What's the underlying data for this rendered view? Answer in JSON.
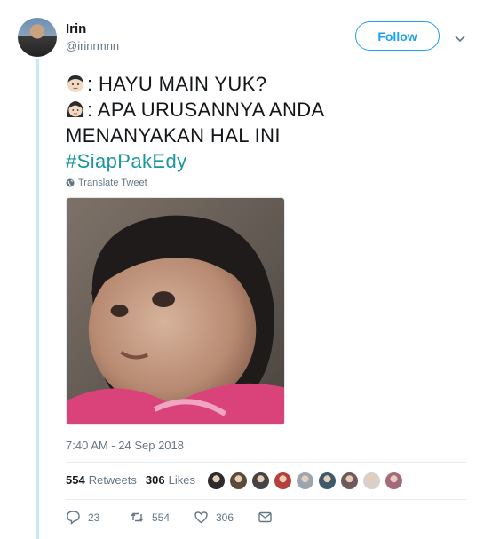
{
  "author": {
    "display_name": "Irin",
    "username": "@irinrmnn"
  },
  "follow_label": "Follow",
  "tweet": {
    "line1": ": HAYU MAIN YUK?",
    "line2": ": APA URUSANNYA ANDA",
    "line3": "MENANYAKAN HAL INI",
    "hashtag": "#SiapPakEdy",
    "emoji1": "boy-face-icon",
    "emoji2": "woman-face-icon"
  },
  "translate_label": "Translate Tweet",
  "timestamp": "7:40 AM - 24 Sep 2018",
  "stats": {
    "retweets_count": "554",
    "retweets_label": "Retweets",
    "likes_count": "306",
    "likes_label": "Likes"
  },
  "liker_avatar_colors": [
    "#2b2b2b",
    "#5a4a3a",
    "#444444",
    "#b8403c",
    "#9aa5b1",
    "#3d5a6b",
    "#6e5a5a",
    "#d8d0cc",
    "#a36a7a"
  ],
  "actions": {
    "reply_count": "23",
    "retweet_count": "554",
    "like_count": "306"
  },
  "colors": {
    "accent": "#1da1f2",
    "hashtag": "#1b95a0",
    "thread_line": "#c7ebf0",
    "muted": "#657786"
  }
}
